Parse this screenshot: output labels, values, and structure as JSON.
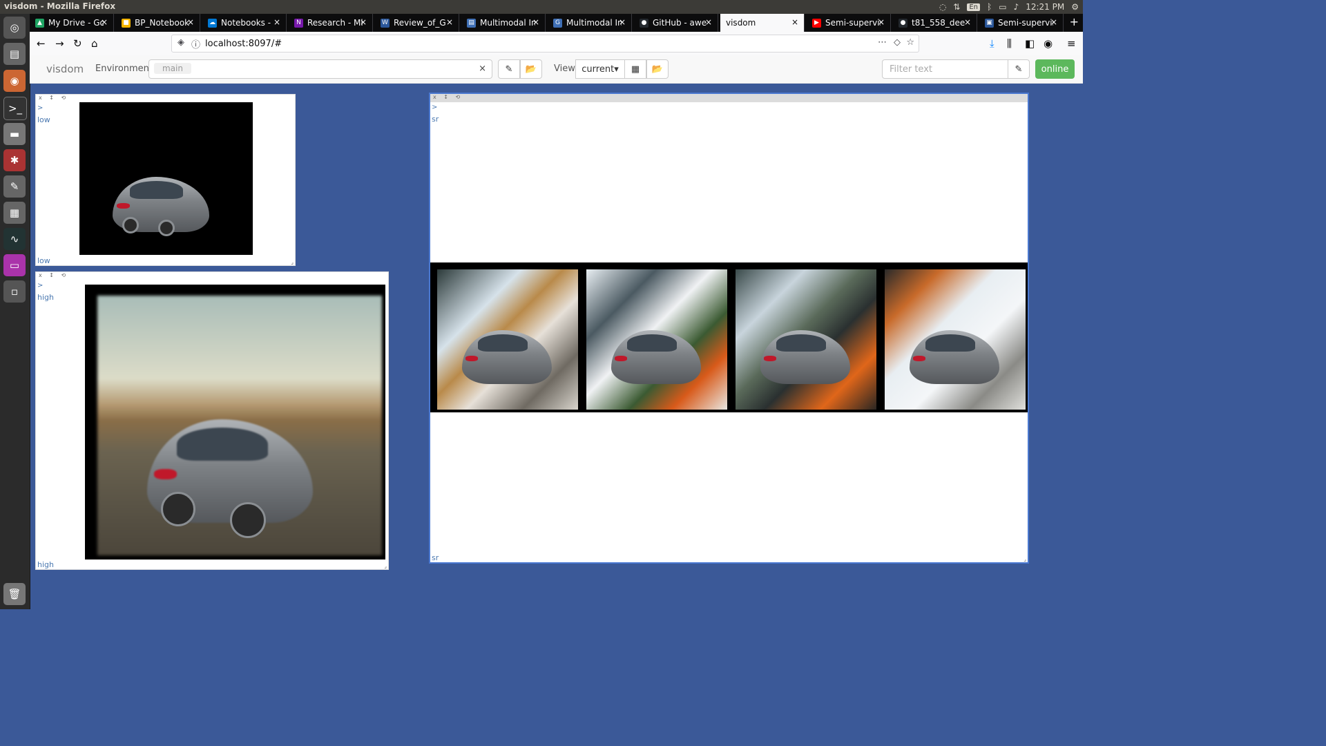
{
  "window_title": "visdom - Mozilla Firefox",
  "system_tray": {
    "lang": "En",
    "time": "12:21 PM"
  },
  "tabs": [
    {
      "label": "My Drive - Go",
      "color": "#1fa463"
    },
    {
      "label": "BP_Notebook",
      "color": "#f4b400"
    },
    {
      "label": "Notebooks - ",
      "color": "#0078d4"
    },
    {
      "label": "Research - Mi",
      "color": "#7719aa"
    },
    {
      "label": "Review_of_G",
      "color": "#2b579a"
    },
    {
      "label": "Multimodal In",
      "color": "#3f6fb5"
    },
    {
      "label": "Multimodal In",
      "color": "#3f6fb5"
    },
    {
      "label": "GitHub - awe",
      "color": "#24292e"
    },
    {
      "label": "visdom",
      "color": "#f9f9fa"
    },
    {
      "label": "Semi-supervis",
      "color": "#ff0000"
    },
    {
      "label": "t81_558_dee",
      "color": "#24292e"
    },
    {
      "label": "Semi-supervis",
      "color": "#2b579a"
    }
  ],
  "address_bar": {
    "url": "localhost:8097/#"
  },
  "visdom": {
    "brand": "visdom",
    "environment_label": "Environment",
    "environment_value": "main",
    "view_label": "View",
    "view_value": "current",
    "filter_placeholder": "Filter text",
    "status": "online"
  },
  "panes": {
    "low": {
      "caret": ">",
      "title": "low",
      "caption": "low"
    },
    "high": {
      "caret": ">",
      "title": "high",
      "caption": "high"
    },
    "sr": {
      "caret": ">",
      "title": "sr",
      "caption": "sr"
    }
  },
  "icons": {
    "pane_controls": "x ↕ ⟲",
    "resize": "⌟",
    "clear": "×",
    "eraser": "✎",
    "folder": "📂",
    "grid": "▦",
    "caret_down": "▾"
  }
}
